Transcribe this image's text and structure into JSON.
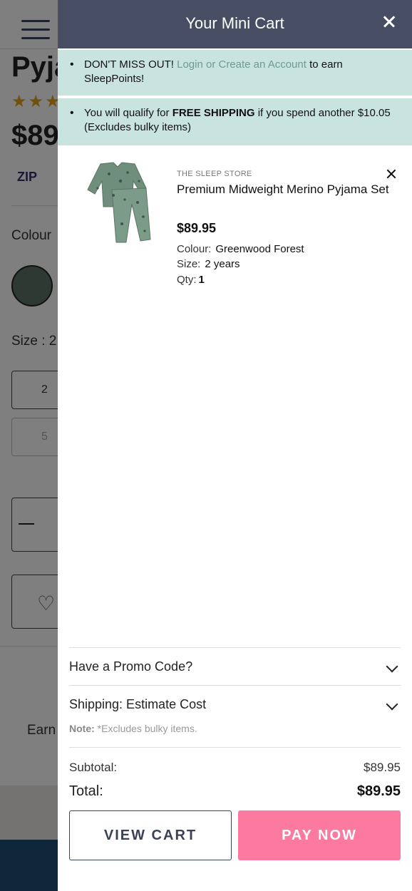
{
  "background_page": {
    "title_fragment": "Pyja",
    "stars": "★★★",
    "price_fragment": "$89",
    "zip_logo": "ZIP",
    "colour_label": "Colour",
    "size_label": "Size : 2",
    "size_option_1": "2",
    "size_option_2": "5",
    "earn_text": "Earn"
  },
  "mini_cart": {
    "title": "Your Mini Cart",
    "notices": {
      "login": {
        "prefix": "DON'T MISS OUT!",
        "link": "Login or Create an Account",
        "suffix": "to earn SleepPoints!"
      },
      "shipping": {
        "prefix": "You will qualify for",
        "bold": "FREE SHIPPING",
        "suffix": "if you spend another $10.05 (Excludes bulky items)"
      }
    },
    "items": [
      {
        "brand": "THE SLEEP STORE",
        "name": "Premium Midweight Merino Pyjama Set",
        "price": "$89.95",
        "colour_label": "Colour:",
        "colour": "Greenwood Forest",
        "size_label": "Size:",
        "size": "2 years",
        "qty_label": "Qty:",
        "qty": "1"
      }
    ],
    "promo_label": "Have a Promo Code?",
    "shipping_label": "Shipping: Estimate Cost",
    "note_label": "Note:",
    "note_text": "*Excludes bulky items.",
    "subtotal_label": "Subtotal:",
    "subtotal_value": "$89.95",
    "total_label": "Total:",
    "total_value": "$89.95",
    "view_cart_label": "VIEW CART",
    "pay_now_label": "PAY NOW"
  },
  "colors": {
    "header_bg": "#474e64",
    "notice_bg": "#c9e4df",
    "link": "#6e9a93",
    "pay_button": "#fc7a9f",
    "view_button_border": "#3b4256"
  }
}
